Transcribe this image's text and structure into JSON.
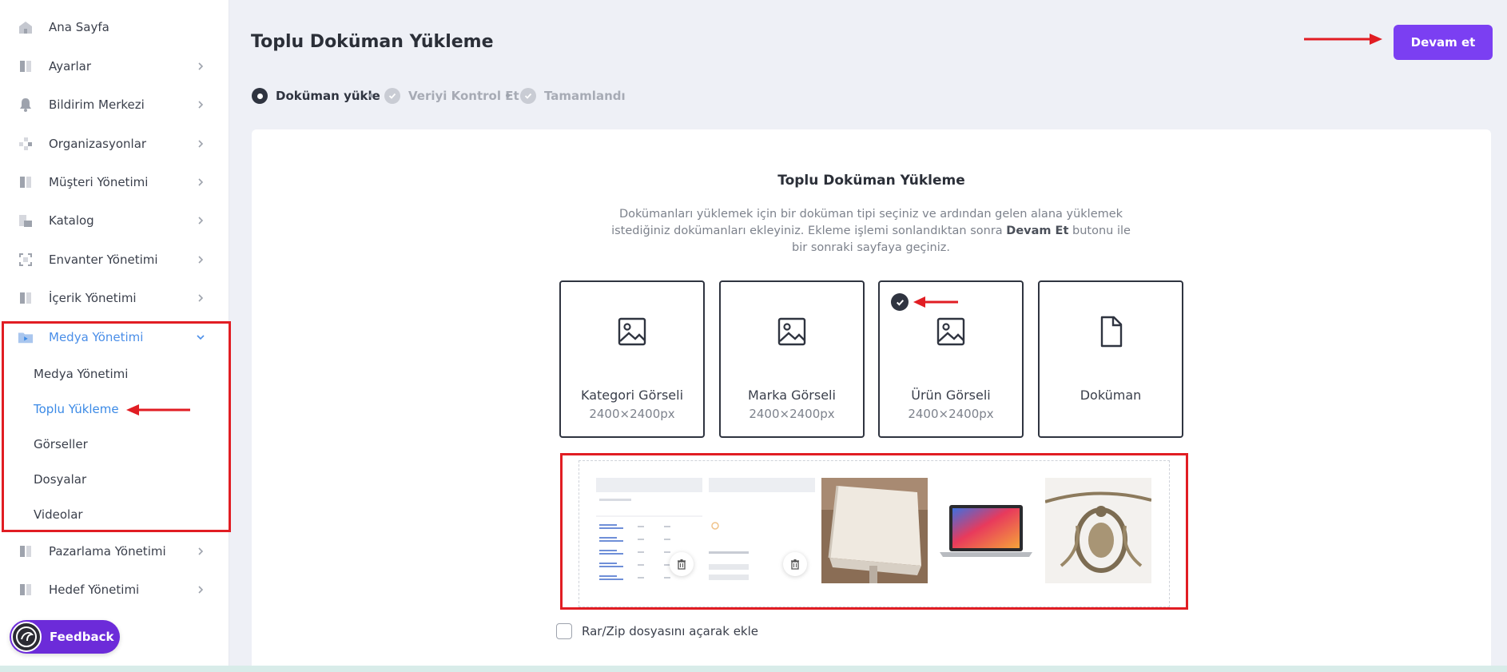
{
  "sidebar": {
    "items": [
      {
        "label": "Ana Sayfa",
        "icon": "home-icon",
        "has_chevron": false
      },
      {
        "label": "Ayarlar",
        "icon": "settings-panel-icon",
        "has_chevron": true
      },
      {
        "label": "Bildirim Merkezi",
        "icon": "bell-icon",
        "has_chevron": true
      },
      {
        "label": "Organizasyonlar",
        "icon": "organization-icon",
        "has_chevron": true
      },
      {
        "label": "Müşteri Yönetimi",
        "icon": "customer-icon",
        "has_chevron": true
      },
      {
        "label": "Katalog",
        "icon": "catalog-icon",
        "has_chevron": true
      },
      {
        "label": "Envanter Yönetimi",
        "icon": "inventory-icon",
        "has_chevron": true
      },
      {
        "label": "İçerik Yönetimi",
        "icon": "content-icon",
        "has_chevron": true
      },
      {
        "label": "Medya Yönetimi",
        "icon": "media-folder-icon",
        "has_chevron": true,
        "expanded": true
      },
      {
        "label": "Pazarlama Yönetimi",
        "icon": "marketing-icon",
        "has_chevron": true
      },
      {
        "label": "Hedef Yönetimi",
        "icon": "target-icon",
        "has_chevron": true
      }
    ],
    "media_subitems": [
      {
        "label": "Medya Yönetimi",
        "active": false
      },
      {
        "label": "Toplu Yükleme",
        "active": true
      },
      {
        "label": "Görseller",
        "active": false
      },
      {
        "label": "Dosyalar",
        "active": false
      },
      {
        "label": "Videolar",
        "active": false
      }
    ],
    "feedback_label": "Feedback"
  },
  "header": {
    "title": "Toplu Doküman Yükleme",
    "continue_label": "Devam et"
  },
  "stepper": [
    {
      "label": "Doküman yükle",
      "state": "current"
    },
    {
      "label": "Veriyi Kontrol Et",
      "state": "pending"
    },
    {
      "label": "Tamamlandı",
      "state": "pending"
    }
  ],
  "upload": {
    "title": "Toplu Doküman Yükleme",
    "description_part1": "Dokümanları yüklemek için bir doküman tipi seçiniz ve ardından gelen alana yüklemek istediğiniz dokümanları ekleyiniz. Ekleme işlemi sonlandıktan sonra ",
    "description_bold": "Devam Et",
    "description_part2": " butonu ile bir sonraki sayfaya geçiniz.",
    "types": [
      {
        "name": "Kategori Görseli",
        "size": "2400×2400px",
        "icon": "image-icon",
        "selected": false
      },
      {
        "name": "Marka Görseli",
        "size": "2400×2400px",
        "icon": "image-icon",
        "selected": false
      },
      {
        "name": "Ürün Görseli",
        "size": "2400×2400px",
        "icon": "image-icon",
        "selected": true
      },
      {
        "name": "Doküman",
        "size": "",
        "icon": "document-icon",
        "selected": false
      }
    ],
    "thumbnails": [
      {
        "kind": "document-preview",
        "deletable": true
      },
      {
        "kind": "document-preview",
        "deletable": true
      },
      {
        "kind": "tablecloth-photo",
        "deletable": false
      },
      {
        "kind": "laptop-photo",
        "deletable": false
      },
      {
        "kind": "embroidery-photo",
        "deletable": false
      }
    ],
    "zip_option_label": "Rar/Zip dosyasını açarak ekle",
    "zip_option_checked": false
  },
  "colors": {
    "accent": "#7b3ff2",
    "active_link": "#3b8ae6",
    "annotation_red": "#e11d23",
    "background": "#eef0f6"
  }
}
